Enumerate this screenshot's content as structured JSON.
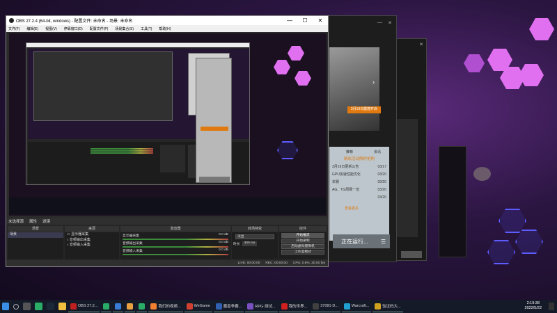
{
  "obs": {
    "title": "OBS 27.2.4 (64-bit, windows) - 配置文件: 未命名 - 场景: 未命名",
    "window_controls": [
      "—",
      "☐",
      "✕"
    ],
    "menu": [
      "文件(F)",
      "编辑(E)",
      "视图(V)",
      "停靠窗口(D)",
      "配置文件(P)",
      "场景集合(S)",
      "工具(T)",
      "帮助(H)"
    ],
    "dock_tabs": [
      "未选择源",
      "属性",
      "滤镜"
    ],
    "scenes": {
      "header": "场景",
      "items": [
        "场景"
      ]
    },
    "sources": {
      "header": "来源",
      "items": [
        "显示器采集",
        "音频输出采集",
        "音频输入采集"
      ]
    },
    "mixer": {
      "header": "混音器",
      "channels": [
        {
          "name": "显示器采集",
          "db": "0.0 dB"
        },
        {
          "name": "音频输出采集",
          "db": "0.0 dB"
        },
        {
          "name": "音频输入采集",
          "db": "0.0 dB"
        }
      ]
    },
    "transitions": {
      "header": "转场特效",
      "type": "淡出",
      "duration_label": "时长",
      "duration_value": "300 ms"
    },
    "controls": {
      "header": "控件",
      "buttons": [
        "开始推流",
        "开始录制",
        "启动虚拟摄像机",
        "工作室模式",
        "设置",
        "退出"
      ]
    },
    "status": {
      "live": "LIVE: 00:00:00",
      "rec": "REC: 00:00:00",
      "cpu": "CPU: 0.8%, 30.00 fps"
    }
  },
  "client": {
    "promo_button": "3月19日震撼开启",
    "list_tabs": [
      "推荐",
      "资讯"
    ],
    "list_title": "精彩活动限时抢购",
    "list_items": [
      {
        "text": "3月19日更新公告",
        "date": "03/17"
      },
      {
        "text": "GPU加速性能优化",
        "date": "03/20"
      },
      {
        "text": "本赛",
        "date": "03/20"
      },
      {
        "text": "AG、TG周赛一览",
        "date": "03/20"
      },
      {
        "text": "",
        "date": "03/20"
      }
    ],
    "list_footer": "查看更多",
    "running_label": "正在运行...",
    "running_icon": "menu-icon"
  },
  "taskbar": {
    "apps": [
      {
        "label": "OBS 27.2...",
        "color": "#c02020"
      },
      {
        "label": "微信",
        "color": "#2aae67"
      },
      {
        "label": "",
        "color": "#3a7bd5"
      },
      {
        "label": "",
        "color": "#e8a040"
      },
      {
        "label": "微信",
        "color": "#2aae67"
      },
      {
        "label": "我们的视频...",
        "color": "#f08030"
      },
      {
        "label": "WeGame",
        "color": "#d04030"
      },
      {
        "label": "魔兽争霸...",
        "color": "#3060b0"
      },
      {
        "label": "RPG·测试...",
        "color": "#7a50c0"
      },
      {
        "label": "我的世界...",
        "color": "#d02020"
      },
      {
        "label": "37081·D...",
        "color": "#404040"
      },
      {
        "label": "Warcraft...",
        "color": "#20a0d0"
      },
      {
        "label": "验证码大...",
        "color": "#d0a020"
      }
    ],
    "time": "2:19:38",
    "date": "2022/5/22"
  },
  "colors": {
    "accent": "#e07a10",
    "hex_pink": "#e070f0",
    "neon_blue": "#5c5cff"
  }
}
